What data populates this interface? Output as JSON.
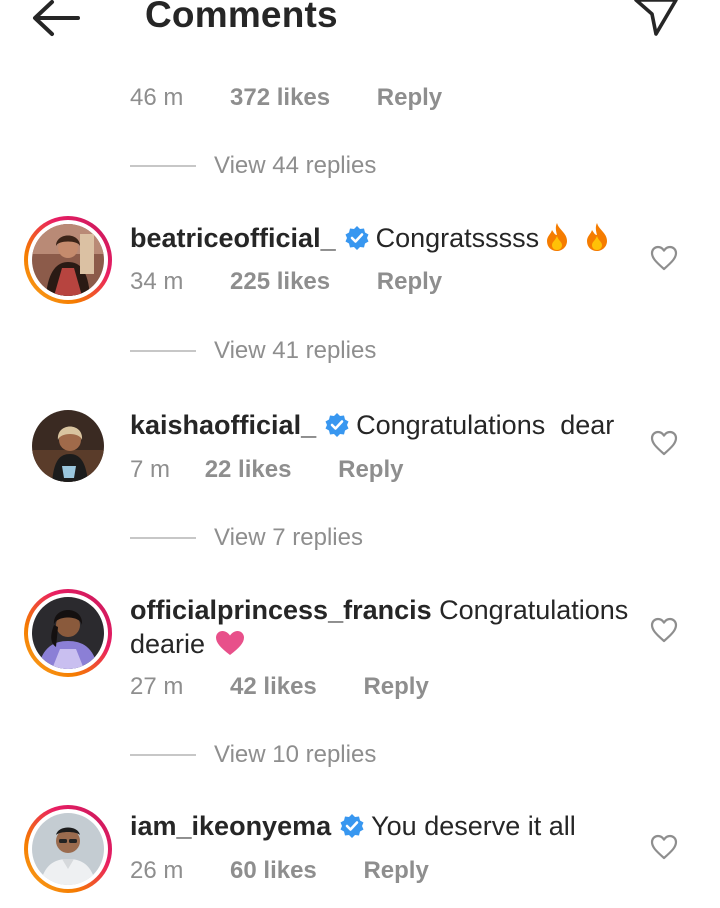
{
  "header": {
    "title": "Comments",
    "back_icon": "arrow-left-icon",
    "share_icon": "paper-plane-icon"
  },
  "top_comment": {
    "time": "46 m",
    "likes": "372 likes",
    "reply": "Reply",
    "view_replies": "View 44 replies"
  },
  "comments": [
    {
      "username": "beatriceofficial_",
      "verified": true,
      "text": "Congratsssss",
      "emoji": [
        "fire",
        "fire"
      ],
      "time": "34 m",
      "likes": "225 likes",
      "reply": "Reply",
      "view_replies": "View 41 replies",
      "story_ring": true
    },
    {
      "username": "kaishaofficial_",
      "verified": true,
      "text": "Congratulations  dear",
      "time": "7 m",
      "likes": "22 likes",
      "reply": "Reply",
      "view_replies": "View 7 replies",
      "story_ring": false
    },
    {
      "username": "officialprincess_francis",
      "verified": false,
      "text": "Congratulations dearie",
      "emoji": [
        "pink-heart"
      ],
      "time": "27 m",
      "likes": "42 likes",
      "reply": "Reply",
      "view_replies": "View 10 replies",
      "story_ring": true
    },
    {
      "username": "iam_ikeonyema",
      "verified": true,
      "text": "You deserve it all",
      "time": "26 m",
      "likes": "60 likes",
      "reply": "Reply",
      "story_ring": true
    }
  ],
  "colors": {
    "text": "#262626",
    "secondary": "#8e8e8e",
    "verified": "#3897f0",
    "heart_emoji": "#e8508a",
    "ring_start": "#f9a825",
    "ring_end": "#c2185b"
  }
}
